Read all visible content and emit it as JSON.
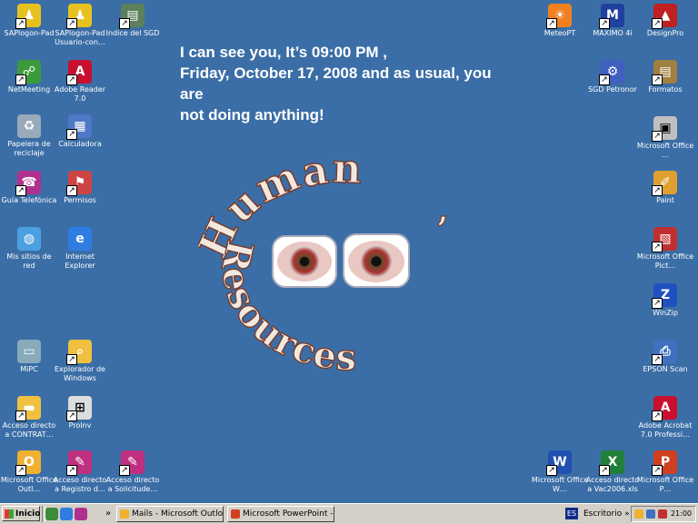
{
  "headline": {
    "line1": "I can see you, It’s 09:00 PM ,",
    "line2": "Friday, October 17, 2008 and as usual, you",
    "line3": "are",
    "line4": "not doing anything!"
  },
  "wallpaper": {
    "arc_top": "Human",
    "arc_bottom": "Resources",
    "apostrophe": "’"
  },
  "icons_left": [
    {
      "label": "SAPlogon-Pad",
      "icon": "sap-logon-icon",
      "color": "#e7c21f"
    },
    {
      "label": "SAPlogon-Pad Usuario-con…",
      "icon": "sap-logon-icon",
      "color": "#e7c21f"
    },
    {
      "label": "Indice del SGD",
      "icon": "sgd-index-icon",
      "color": "#5c7f5c"
    },
    {
      "label": "NetMeeting",
      "icon": "netmeeting-icon",
      "color": "#3b9b3b"
    },
    {
      "label": "Adobe Reader 7.0",
      "icon": "adobe-reader-icon",
      "color": "#c8102e"
    },
    {
      "label": "Papelera de reciclaje",
      "icon": "recycle-bin-icon",
      "color": "#9ab"
    },
    {
      "label": "Calculadora",
      "icon": "calculator-icon",
      "color": "#5078c8"
    },
    {
      "label": "Guía Telefónica",
      "icon": "phone-book-icon",
      "color": "#b03090"
    },
    {
      "label": "Permisos",
      "icon": "permissions-icon",
      "color": "#c44"
    },
    {
      "label": "Mis sitios de red",
      "icon": "network-places-icon",
      "color": "#4da0e0"
    },
    {
      "label": "Internet Explorer",
      "icon": "internet-explorer-icon",
      "color": "#2f7de1"
    },
    {
      "label": "MiPC",
      "icon": "my-computer-icon",
      "color": "#8ab"
    },
    {
      "label": "Explorador de Windows",
      "icon": "windows-explorer-icon",
      "color": "#f0c040"
    },
    {
      "label": "Acceso directo a CONTRAT…",
      "icon": "folder-icon",
      "color": "#f0c040"
    },
    {
      "label": "ProInv",
      "icon": "proinv-icon",
      "color": "#ddd"
    },
    {
      "label": "Microsoft Office Outl…",
      "icon": "outlook-icon",
      "color": "#f0b030"
    },
    {
      "label": "Acceso directo a Registro d…",
      "icon": "document-shortcut-icon",
      "color": "#c03080"
    },
    {
      "label": "Acceso directo a Solicitude…",
      "icon": "document-shortcut-icon",
      "color": "#c03080"
    }
  ],
  "icons_right": [
    {
      "label": "MeteoPT",
      "icon": "meteo-icon",
      "color": "#f08020"
    },
    {
      "label": "MAXIMO 4i",
      "icon": "maximo-icon",
      "color": "#2040a0"
    },
    {
      "label": "DesignPro",
      "icon": "designpro-icon",
      "color": "#c02020"
    },
    {
      "label": "SGD Petronor",
      "icon": "sgd-petronor-icon",
      "color": "#4060c0"
    },
    {
      "label": "Formatos",
      "icon": "formats-icon",
      "color": "#a08040"
    },
    {
      "label": "Microsoft Office …",
      "icon": "office-icon",
      "color": "#c0c0c0"
    },
    {
      "label": "Paint",
      "icon": "paint-icon",
      "color": "#e0a030"
    },
    {
      "label": "Microsoft Office Pict…",
      "icon": "office-picture-icon",
      "color": "#c03030"
    },
    {
      "label": "WinZip",
      "icon": "winzip-icon",
      "color": "#2050c0"
    },
    {
      "label": "EPSON Scan",
      "icon": "epson-scan-icon",
      "color": "#4070c0"
    },
    {
      "label": "Adobe Acrobat 7.0 Professi…",
      "icon": "acrobat-icon",
      "color": "#c8102e"
    },
    {
      "label": "Microsoft Office W…",
      "icon": "word-icon",
      "color": "#2050b0"
    },
    {
      "label": "Acceso directo a Vac2006.xls",
      "icon": "excel-icon",
      "color": "#20803a"
    },
    {
      "label": "Microsoft Office P…",
      "icon": "powerpoint-icon",
      "color": "#d04020"
    }
  ],
  "taskbar": {
    "start_label": "Inicio",
    "chevron": "»",
    "tasks": [
      {
        "label": "Mails - Microsoft Outlook",
        "color": "#f0b030"
      },
      {
        "label": "Microsoft PowerPoint - […",
        "color": "#d04020"
      }
    ],
    "language": "ES",
    "deskbar_label": "Escritorio",
    "clock": "21:00"
  }
}
